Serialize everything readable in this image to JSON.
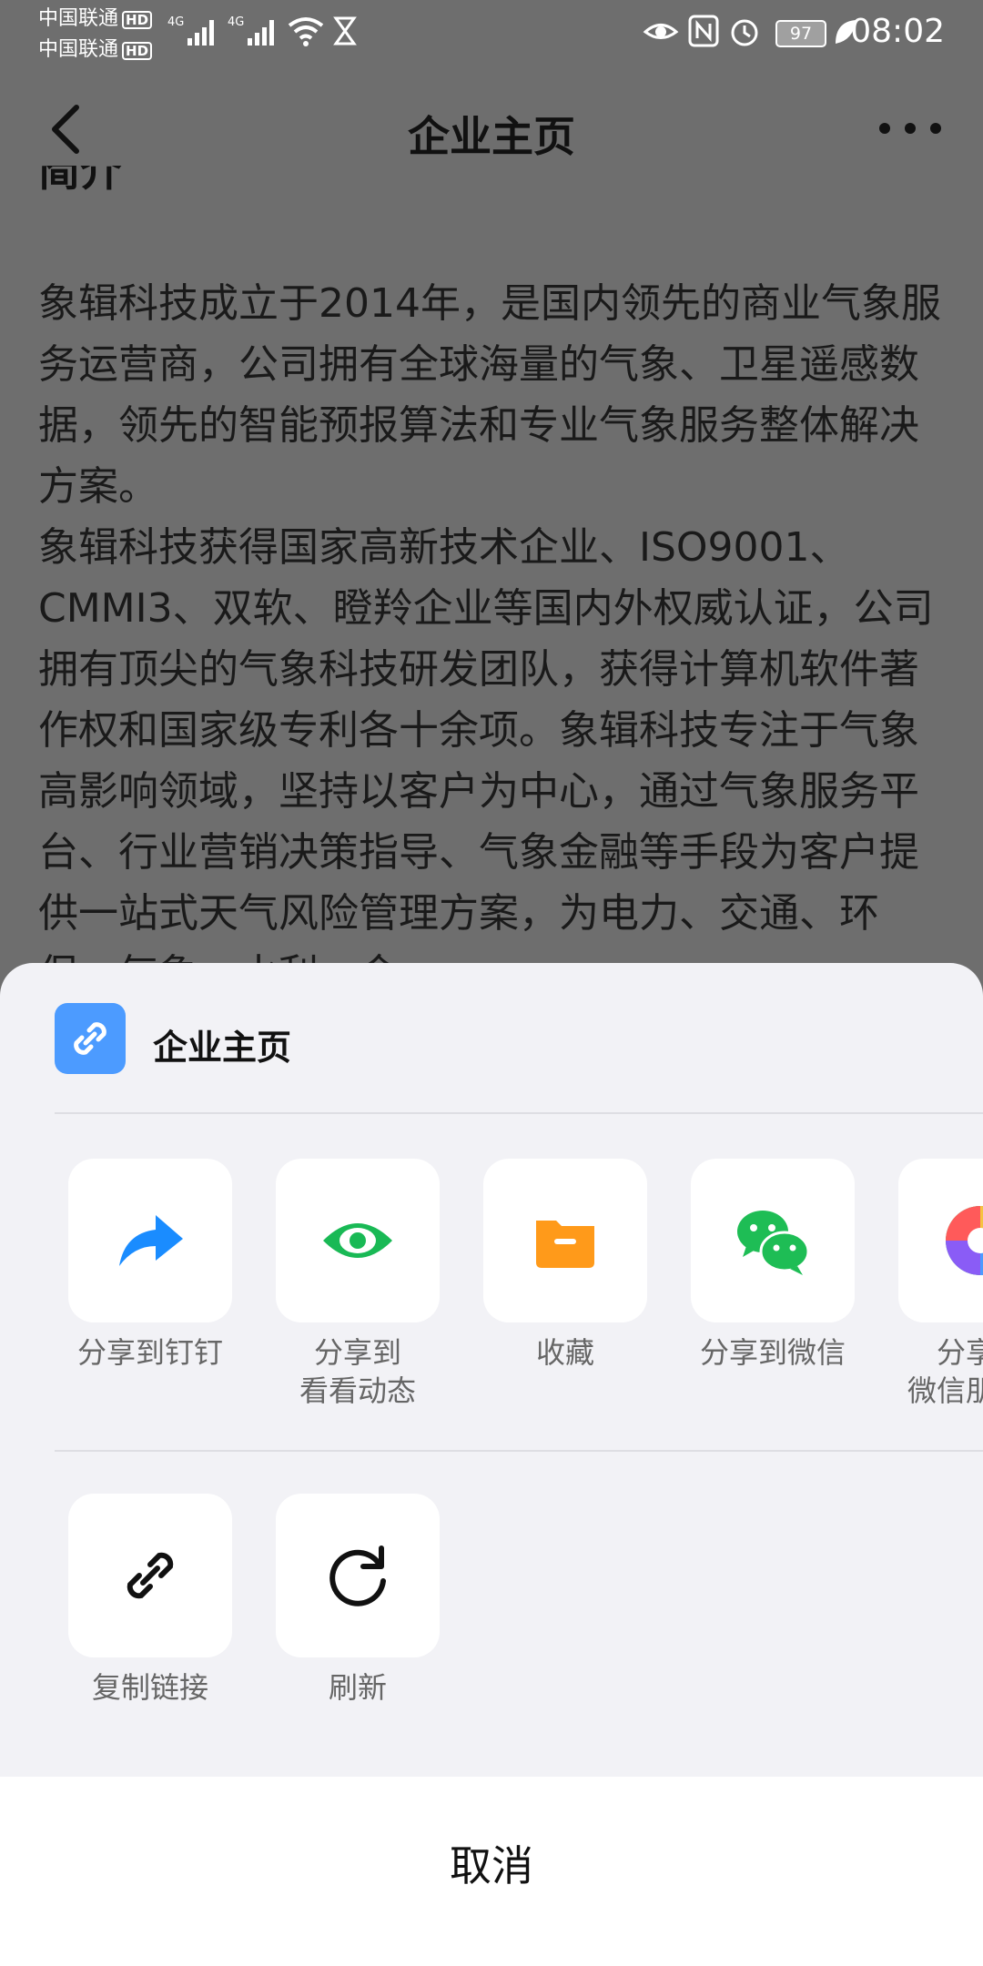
{
  "status_bar": {
    "carrier1": "中国联通",
    "carrier2": "中国联通",
    "hd_badge": "HD",
    "network1": "4G",
    "network2": "4G",
    "battery": "97",
    "time": "08:02"
  },
  "header": {
    "title": "企业主页"
  },
  "article": {
    "cut_heading": "简介",
    "paragraph1": "象辑科技成立于2014年，是国内领先的商业气象服务运营商，公司拥有全球海量的气象、卫星遥感数据，领先的智能预报算法和专业气象服务整体解决方案。",
    "paragraph2": "象辑科技获得国家高新技术企业、ISO9001、CMMI3、双软、瞪羚企业等国内外权威认证，公司拥有顶尖的气象科技研发团队，获得计算机软件著作权和国家级专利各十余项。象辑科技专注于气象高影响领域，坚持以客户为中心，通过气象服务平台、行业营销决策指导、气象金融等手段为客户提供一站式天气风险管理方案，为电力、交通、环保、气象、水利、金"
  },
  "share_sheet": {
    "title": "企业主页",
    "row1": [
      {
        "label": "分享到钉钉",
        "icon": "share-arrow-icon",
        "color": "#1a8cff"
      },
      {
        "label": "分享到\n看看动态",
        "icon": "eye-icon",
        "color": "#19b955"
      },
      {
        "label": "收藏",
        "icon": "folder-icon",
        "color": "#ff9a1a"
      },
      {
        "label": "分享到微信",
        "icon": "wechat-icon",
        "color": "#1ebd55"
      },
      {
        "label": "分享到\n微信朋友圈",
        "icon": "moments-icon",
        "color": "#f6c342"
      }
    ],
    "row2": [
      {
        "label": "复制链接",
        "icon": "link-icon",
        "color": "#111111"
      },
      {
        "label": "刷新",
        "icon": "refresh-icon",
        "color": "#111111"
      }
    ],
    "cancel": "取消"
  }
}
